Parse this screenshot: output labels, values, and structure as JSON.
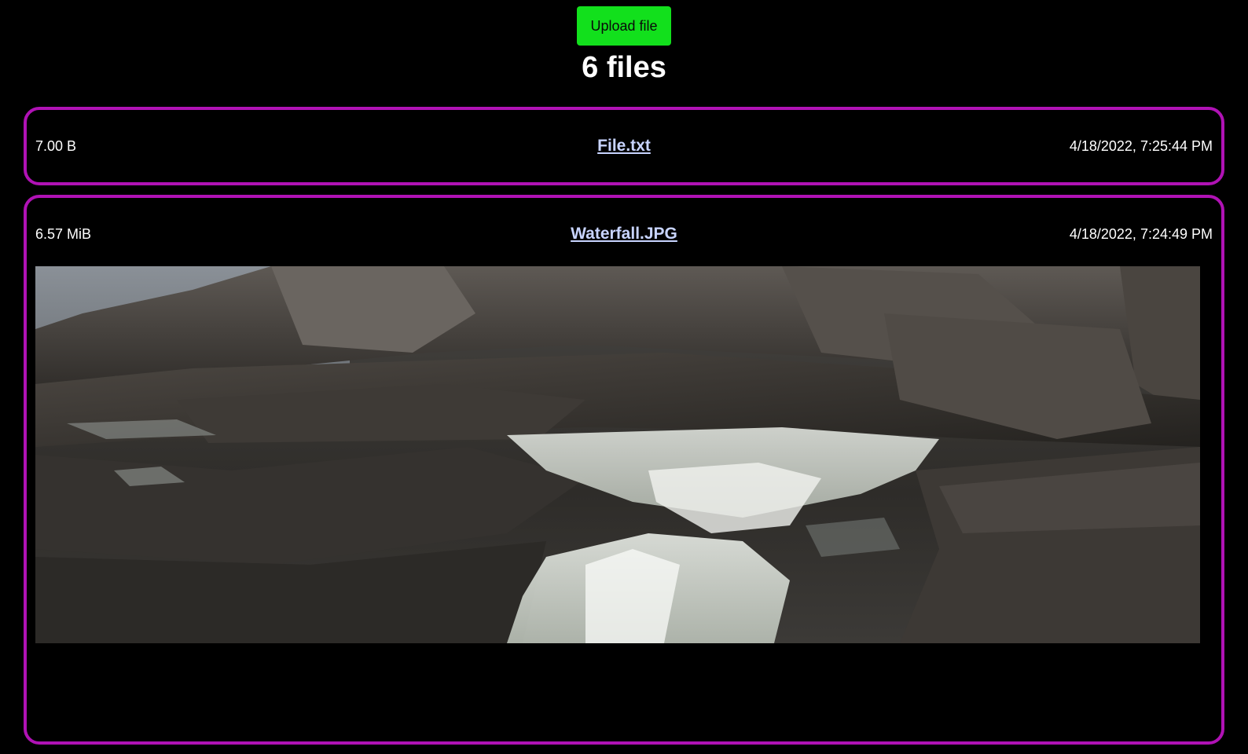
{
  "upload_button": {
    "label": "Upload file"
  },
  "file_count_title": "6 files",
  "files": [
    {
      "size": "7.00 B",
      "name": "File.txt",
      "date": "4/18/2022, 7:25:44 PM"
    },
    {
      "size": "6.57 MiB",
      "name": "Waterfall.JPG",
      "date": "4/18/2022, 7:24:49 PM"
    }
  ],
  "colors": {
    "accent_button": "#12e01c",
    "card_border": "#b012b5",
    "link": "#c8d4ff",
    "background": "#000000"
  }
}
